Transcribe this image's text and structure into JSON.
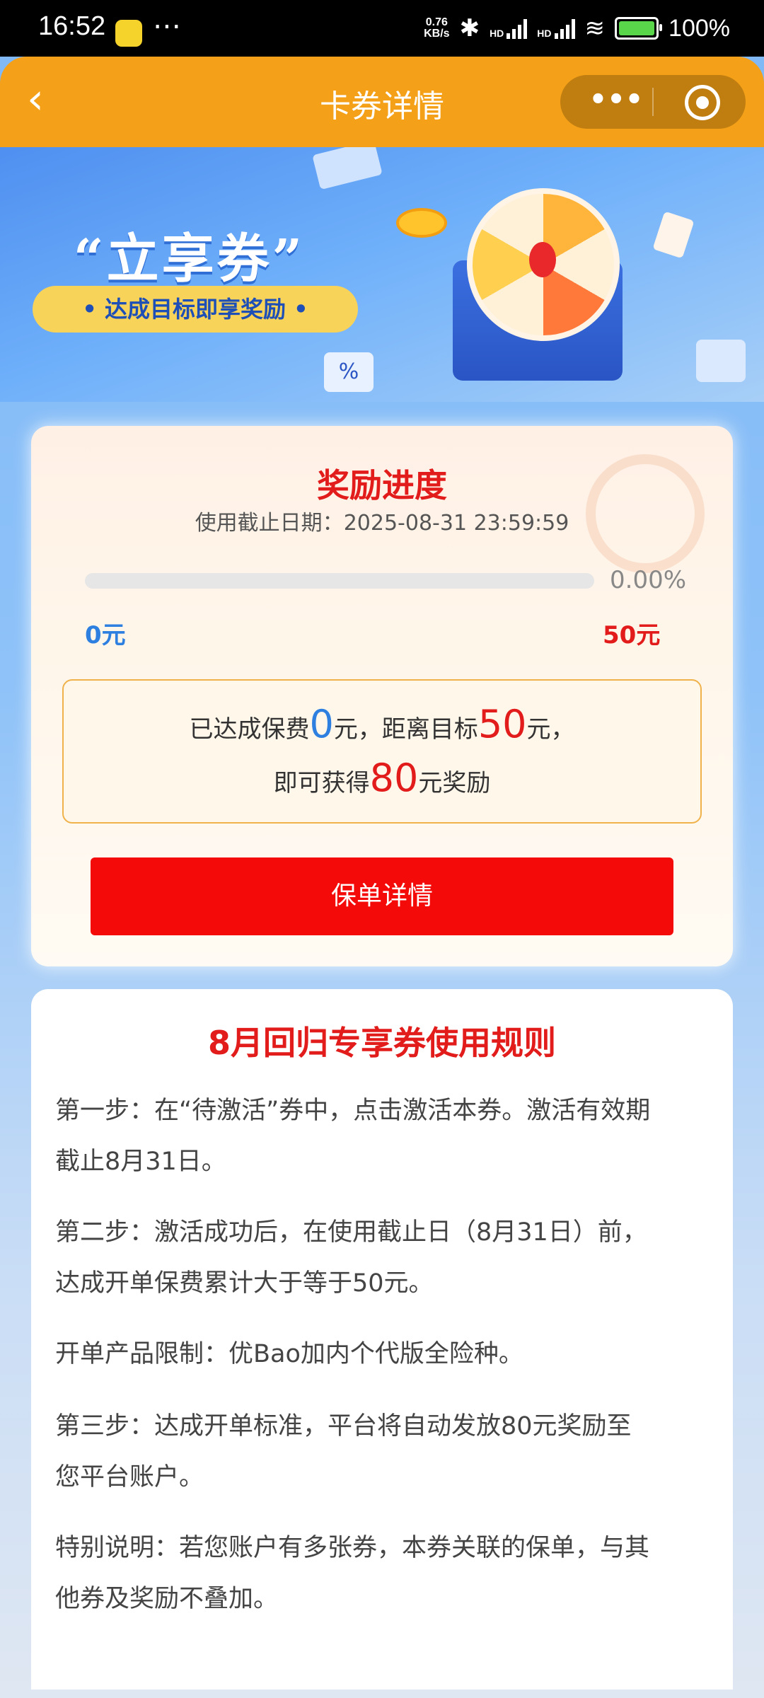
{
  "status_bar": {
    "time": "16:52",
    "net_speed_value": "0.76",
    "net_speed_unit": "KB/s",
    "hd1": "HD",
    "hd2": "HD",
    "battery_percent": "100%"
  },
  "header": {
    "title": "卡券详情",
    "more_label": "•••"
  },
  "banner": {
    "title": "“立享券”",
    "subtitle": "• 达成目标即享奖励 •"
  },
  "progress_card": {
    "title": "奖励进度",
    "deadline_label": "使用截止日期：",
    "deadline_value": "2025-08-31 23:59:59",
    "progress_fraction": 0.0,
    "progress_text": "0.00%",
    "min_label": "0元",
    "max_label": "50元",
    "notice_line1_a": "已达成保费",
    "notice_achieved": "0",
    "notice_line1_b": "元，距离目标",
    "notice_target": "50",
    "notice_line1_c": "元，",
    "notice_line2_a": "即可获得",
    "notice_reward": "80",
    "notice_line2_b": "元奖励",
    "button_label": "保单详情"
  },
  "rules_card": {
    "title": "8月回归专享券使用规则",
    "rules": [
      {
        "line1": "第一步：在“待激活”券中，点击激活本券。激活有效期",
        "line2": "截止8月31日。"
      },
      {
        "line1": "第二步：激活成功后，在使用截止日（8月31日）前，",
        "line2": "达成开单保费累计大于等于50元。"
      },
      {
        "line1": "开单产品限制：优Bao加内个代版全险种。",
        "line2": ""
      },
      {
        "line1": "第三步：达成开单标准，平台将自动发放80元奖励至",
        "line2": "您平台账户。"
      },
      {
        "line1": "特别说明：若您账户有多张券，本券关联的保单，与其",
        "line2": "他券及奖励不叠加。"
      }
    ]
  },
  "colors": {
    "header_orange": "#f4a018",
    "accent_red": "#e21b1b",
    "button_red": "#f50a0a",
    "accent_blue": "#2d7fe0"
  }
}
